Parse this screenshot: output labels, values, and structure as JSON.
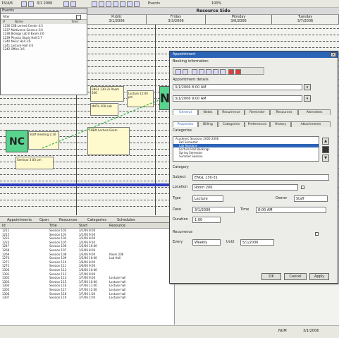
{
  "toolbar": {
    "left_text": "15/4/6",
    "week_label": "3/1 2006",
    "mid_label": "Events",
    "zoom_label": "100%"
  },
  "schedule": {
    "title": "Resource Side",
    "columns": [
      {
        "name": "Public",
        "date": "3/1/2006"
      },
      {
        "name": "Friday",
        "date": "3/3/2006"
      },
      {
        "name": "Monday",
        "date": "3/6/2006"
      },
      {
        "name": "Tuesday",
        "date": "3/7/2006"
      }
    ]
  },
  "left_panel": {
    "title": "Events",
    "search_label": "Filter",
    "header": [
      "#",
      "Name",
      "Time"
    ],
    "rows": [
      "1236 CSB Lerned Center  4:5",
      "1237 Multiverse Science  3:6",
      "1238 Biology Lab II Exam  3:6",
      "1239 Physics Study Hall  5:7",
      "1240 Music Hall  3:6",
      "1241 Lecture Hall  4:6",
      "1242 Office  3:6"
    ]
  },
  "events": {
    "ncs_label": "NCS",
    "nc_label": "NC",
    "e1": "ENGL 130-31 Room 206",
    "e2": "MATH 200 Lab",
    "e3": "Lecture 12:00 pm",
    "e4": "CHEM Lecture Exam",
    "e5": "Staff meeting 2:30",
    "e6": "Seminar 3:00 pm"
  },
  "bottom": {
    "tabs": [
      "Appointments",
      "Open",
      "Resources",
      "Categories",
      "Schedules"
    ],
    "headers": [
      "Id",
      "Title",
      "Start",
      "Resource"
    ],
    "rows": [
      {
        "id": "1211",
        "title": "Session 102",
        "start": "3/1/06 8:00",
        "res": ""
      },
      {
        "id": "1215",
        "title": "Session 103",
        "start": "3/1/06 9:00",
        "res": ""
      },
      {
        "id": "1222",
        "title": "Session 104",
        "start": "3/2/06 8:00",
        "res": ""
      },
      {
        "id": "1223",
        "title": "Session 105",
        "start": "3/2/06 9:30",
        "res": ""
      },
      {
        "id": "1247",
        "title": "Session 106",
        "start": "3/2/06 10:00",
        "res": ""
      },
      {
        "id": "1268",
        "title": "Session 107",
        "start": "3/3/06 8:00",
        "res": ""
      },
      {
        "id": "1269",
        "title": "Session 108",
        "start": "3/3/06 9:00",
        "res": "Room 206"
      },
      {
        "id": "1270",
        "title": "Session 109",
        "start": "3/3/06 10:00",
        "res": "Lab Hall"
      },
      {
        "id": "1271",
        "title": "Session 110",
        "start": "3/6/06 8:00",
        "res": ""
      },
      {
        "id": "1272",
        "title": "Session 111",
        "start": "3/6/06 9:00",
        "res": ""
      },
      {
        "id": "1300",
        "title": "Session 112",
        "start": "3/6/06 10:00",
        "res": ""
      },
      {
        "id": "1301",
        "title": "Session 113",
        "start": "3/7/06 8:00",
        "res": ""
      },
      {
        "id": "1302",
        "title": "Session 114",
        "start": "3/7/06 9:00",
        "res": "Lecture hall"
      },
      {
        "id": "1303",
        "title": "Session 115",
        "start": "3/7/06 10:00",
        "res": "Lecture hall"
      },
      {
        "id": "1304",
        "title": "Session 116",
        "start": "3/7/06 11:00",
        "res": "Lecture hall"
      },
      {
        "id": "1305",
        "title": "Session 117",
        "start": "3/7/06 12:00",
        "res": "Lecture hall"
      },
      {
        "id": "1306",
        "title": "Session 118",
        "start": "3/7/06 1:00",
        "res": "Lecture hall"
      },
      {
        "id": "1307",
        "title": "Session 119",
        "start": "3/7/06 2:00",
        "res": "Lecture hall"
      }
    ]
  },
  "status": {
    "left": "",
    "right1": "NUM",
    "right2": "3/1/2006"
  },
  "dialog": {
    "title": "Appointment",
    "subtitle": "Booking information",
    "section_label": "Appointment details",
    "start_value": "3/1/2006 8:00 AM",
    "end_value": "3/1/2006 9:00 AM",
    "tabs": [
      "General",
      "Notes",
      "Recurrence",
      "Reminder",
      "Resources",
      "Attendees"
    ],
    "subtabs": [
      "Properties",
      "Billing",
      "Categories",
      "Preferences",
      "History",
      "Attachments"
    ],
    "tree_label": "Categories",
    "tree_items": [
      "Academic Sessions 2005-2006",
      "Fall Semester",
      "Lab Sessions",
      "Lecture Hall Bookings",
      "Spring Semester",
      "Summer Session"
    ],
    "category_label": "Category",
    "subject_label": "Subject",
    "subject_value": "ENGL 130-31",
    "location_label": "Location",
    "location_value": "Room 206",
    "type_label": "Type",
    "type_value": "Lecture",
    "owner_label": "Owner",
    "owner_value": "Staff",
    "date_label": "Date",
    "date_value": "3/1/2006",
    "time_label": "Time",
    "time_value": "8:00 AM",
    "duration_label": "Duration",
    "duration_value": "1:00",
    "recurrence_label": "Recurrence",
    "freq_label": "Every",
    "freq_value": "Weekly",
    "until_label": "Until",
    "until_value": "5/1/2006",
    "ok_label": "OK",
    "cancel_label": "Cancel",
    "apply_label": "Apply"
  }
}
